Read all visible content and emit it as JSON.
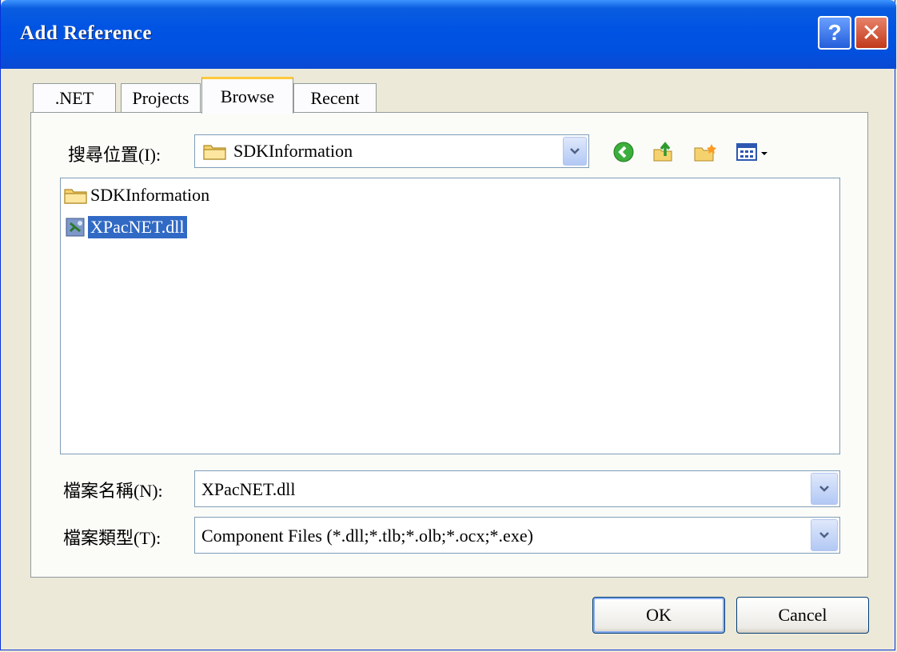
{
  "window": {
    "title": "Add Reference",
    "help_glyph": "?",
    "close_glyph": "✕"
  },
  "tabs": [
    {
      "label": ".NET"
    },
    {
      "label": "Projects"
    },
    {
      "label": "Browse"
    },
    {
      "label": "Recent"
    }
  ],
  "look_in": {
    "label": "搜尋位置(I):",
    "value": "SDKInformation"
  },
  "toolbar": {
    "icons": [
      "back-icon",
      "up-folder-icon",
      "new-folder-icon",
      "view-menu-icon"
    ]
  },
  "files": [
    {
      "name": "SDKInformation",
      "icon": "folder-icon",
      "selected": false
    },
    {
      "name": "XPacNET.dll",
      "icon": "dll-icon",
      "selected": true
    }
  ],
  "file_name": {
    "label": "檔案名稱(N):",
    "value": "XPacNET.dll"
  },
  "file_type": {
    "label": "檔案類型(T):",
    "value": "Component Files (*.dll;*.tlb;*.olb;*.ocx;*.exe)"
  },
  "buttons": {
    "ok": "OK",
    "cancel": "Cancel"
  },
  "colors": {
    "titlebar": "#0054e3",
    "selection": "#316ac5",
    "dialog_bg": "#ece9d8"
  }
}
